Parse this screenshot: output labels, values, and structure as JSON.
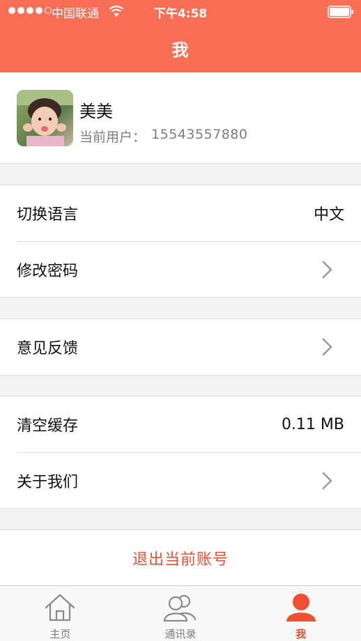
{
  "status_bar": {
    "carrier": "中国联通",
    "time": "下午4:58",
    "signal_bars": 4
  },
  "nav": {
    "title": "我"
  },
  "profile": {
    "name": "美美",
    "user_label": "当前用户：",
    "user_value": "15543557880"
  },
  "settings": {
    "language": {
      "label": "切换语言",
      "value": "中文"
    },
    "password": {
      "label": "修改密码"
    },
    "feedback": {
      "label": "意见反馈"
    },
    "cache": {
      "label": "清空缓存",
      "value": "0.11 MB"
    },
    "about": {
      "label": "关于我们"
    }
  },
  "logout_label": "退出当前账号",
  "tabs": [
    {
      "label": "主页",
      "icon": "home-icon",
      "active": false
    },
    {
      "label": "通讯录",
      "icon": "contacts-icon",
      "active": false
    },
    {
      "label": "我",
      "icon": "profile-icon",
      "active": true
    }
  ],
  "colors": {
    "brand": "#f96e54",
    "accent_text": "#f14f33",
    "background": "#f3f3f3"
  }
}
